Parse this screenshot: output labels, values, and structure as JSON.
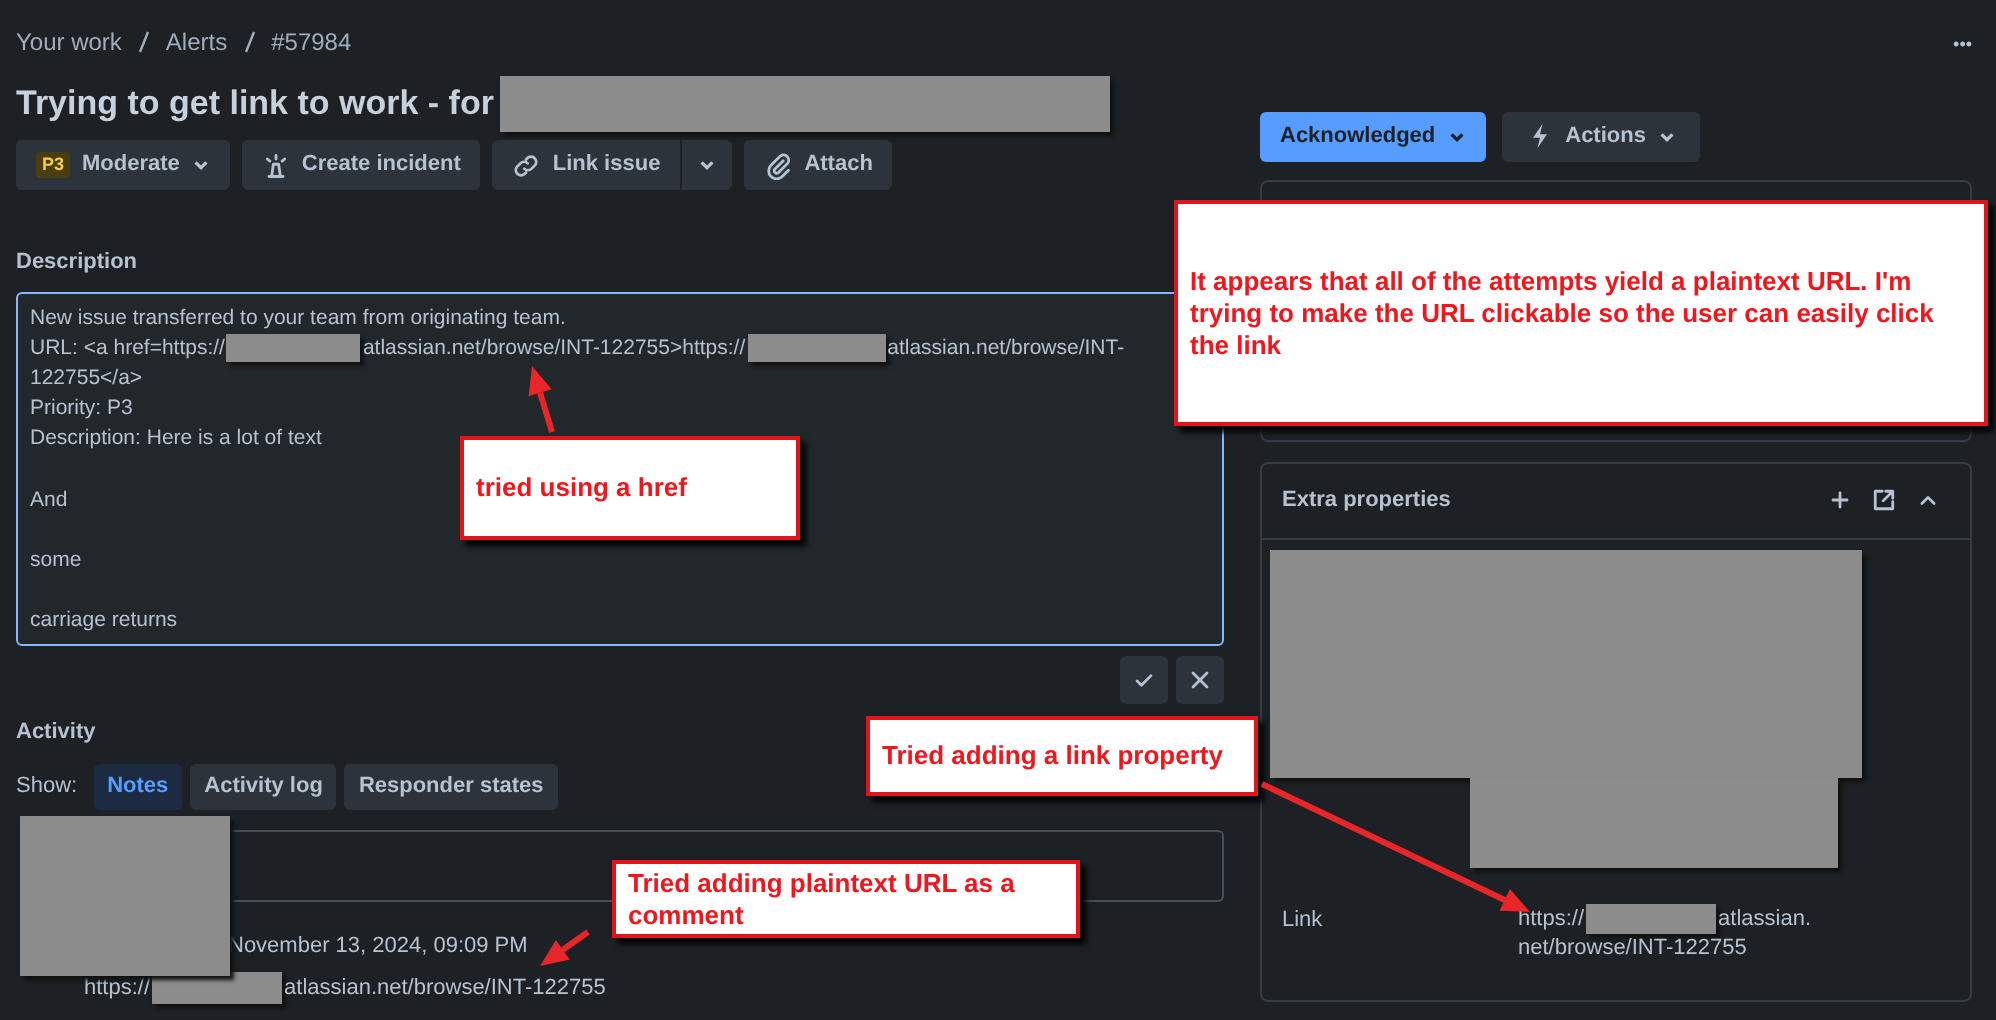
{
  "breadcrumb": [
    "Your work",
    "Alerts",
    "#57984"
  ],
  "title": "Trying to get link to work - for",
  "more_menu": "•••",
  "toolbar": [
    {
      "kind": "priority",
      "badge": "P3",
      "label": "Moderate"
    },
    {
      "kind": "incident",
      "label": "Create incident"
    },
    {
      "kind": "link",
      "label": "Link issue"
    },
    {
      "kind": "attach",
      "label": "Attach"
    }
  ],
  "description": {
    "heading": "Description",
    "lines": [
      {
        "kind": "text",
        "parts": [
          "New issue transferred to your team from originating team."
        ]
      },
      {
        "kind": "url",
        "parts": [
          "URL: <a href=https://",
          "atlassian.net/browse/INT-122755>https://",
          "atlassian.net/browse/INT-",
          "122755</a>"
        ]
      },
      {
        "kind": "text",
        "parts": [
          "Priority: P3"
        ]
      },
      {
        "kind": "text",
        "parts": [
          "Description: Here is a lot of text"
        ]
      },
      {
        "kind": "blank"
      },
      {
        "kind": "text",
        "parts": [
          "And"
        ]
      },
      {
        "kind": "blank"
      },
      {
        "kind": "text",
        "parts": [
          "some"
        ]
      },
      {
        "kind": "blank"
      },
      {
        "kind": "text",
        "parts": [
          "carriage returns"
        ]
      }
    ]
  },
  "activity": {
    "heading": "Activity",
    "show_label": "Show:",
    "filters": [
      {
        "label": "Notes",
        "selected": true
      },
      {
        "label": "Activity log",
        "selected": false
      },
      {
        "label": "Responder states",
        "selected": false
      }
    ],
    "comment": {
      "time": "November 13, 2024, 09:09 PM",
      "url_parts": [
        "https://",
        "atlassian.net/browse/INT-122755"
      ]
    }
  },
  "status_button": "Acknowledged",
  "actions_button": "Actions",
  "extra_properties": {
    "title": "Extra properties",
    "link_label": "Link",
    "link_parts": [
      "https://",
      "atlassian.",
      "net/browse/INT-122755"
    ]
  },
  "annotations": [
    "It appears that all of the attempts yield a plaintext URL. I'm trying to make the URL clickable so the user can easily click the link",
    "tried using a href",
    "Tried adding a link property",
    "Tried adding plaintext URL as a comment"
  ]
}
